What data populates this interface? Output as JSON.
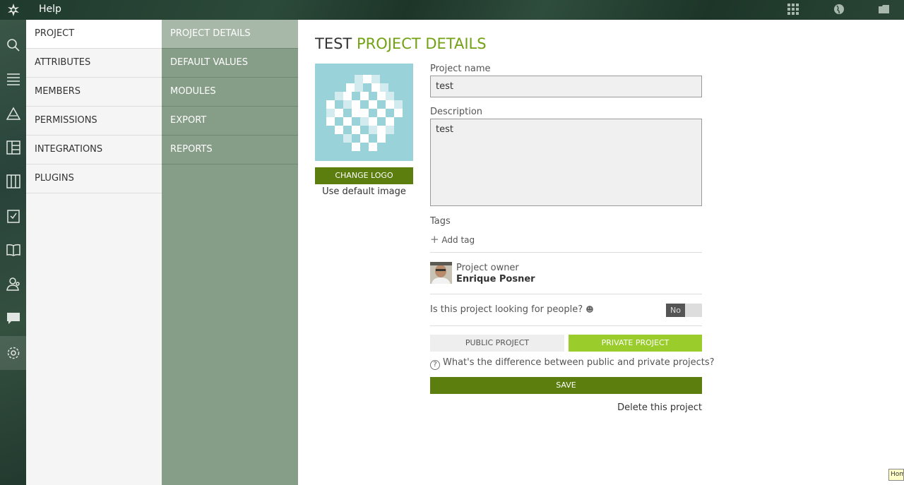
{
  "topbar": {
    "help": "Help",
    "icons": [
      "taiga-logo-icon",
      "apps-grid-icon",
      "globe-icon",
      "folder-icon"
    ]
  },
  "rail": {
    "icons": [
      "search-icon",
      "backlog-icon",
      "epics-icon",
      "kanban-icon",
      "taskboard-icon",
      "tasks-icon",
      "wiki-icon",
      "team-icon",
      "chat-icon",
      "settings-icon"
    ]
  },
  "menu1": {
    "items": [
      "PROJECT",
      "ATTRIBUTES",
      "MEMBERS",
      "PERMISSIONS",
      "INTEGRATIONS",
      "PLUGINS"
    ]
  },
  "menu2": {
    "items": [
      "PROJECT DETAILS",
      "DEFAULT VALUES",
      "MODULES",
      "EXPORT",
      "REPORTS"
    ]
  },
  "content": {
    "title_prefix": "TEST",
    "title_highlight": "PROJECT DETAILS",
    "change_logo": "CHANGE LOGO",
    "use_default": "Use default image",
    "project_name_label": "Project name",
    "project_name_value": "test",
    "description_label": "Description",
    "description_value": "test",
    "tags_label": "Tags",
    "add_tag": "Add tag",
    "owner_label": "Project owner",
    "owner_name": "Enrique Posner",
    "looking_label": "Is this project looking for people?",
    "toggle_value": "No",
    "public_project": "PUBLIC PROJECT",
    "private_project": "PRIVATE PROJECT",
    "difference_question": "What's the difference between public and private projects?",
    "save": "SAVE",
    "delete": "Delete this project"
  },
  "tooltip": "Hom",
  "colors": {
    "accent": "#72a114",
    "button_dark": "#5b7e0e",
    "button_light": "#9acd2b",
    "menu2_bg": "#869d88",
    "logo_bg": "#99d3d9"
  }
}
